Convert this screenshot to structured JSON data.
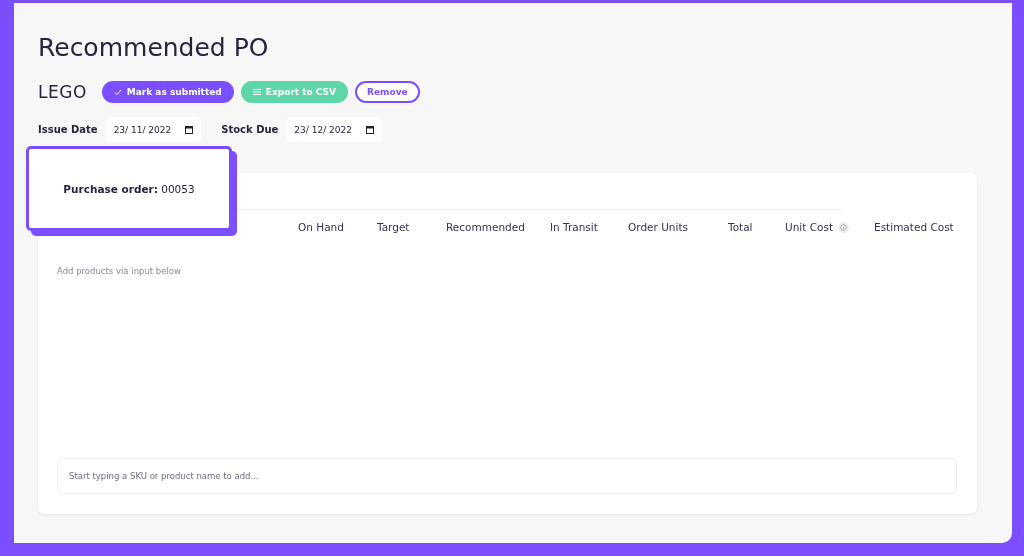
{
  "page": {
    "title": "Recommended PO"
  },
  "supplier": "LEGO",
  "actions": [
    {
      "label": "Mark as submitted",
      "kind": "primary"
    },
    {
      "label": "Export to CSV",
      "kind": "export"
    },
    {
      "label": "Remove",
      "kind": "outline"
    }
  ],
  "dates": [
    {
      "label": "Issue Date",
      "value": "23/ 11/ 2022"
    },
    {
      "label": "Stock Due",
      "value": "23/ 12/ 2022"
    }
  ],
  "tooltip": {
    "label": "Purchase order:",
    "value": "00053"
  },
  "table": {
    "columns": [
      {
        "label": "On Hand"
      },
      {
        "label": "Target"
      },
      {
        "label": "Recommended"
      },
      {
        "label": "In Transit"
      },
      {
        "label": "Order Units"
      },
      {
        "label": "Total"
      },
      {
        "label": "Unit Cost",
        "info": true
      },
      {
        "label": "Estimated Cost"
      }
    ],
    "empty_text": "Add products via input below"
  },
  "add_field": {
    "placeholder": "Start typing a SKU or product name to add..."
  }
}
